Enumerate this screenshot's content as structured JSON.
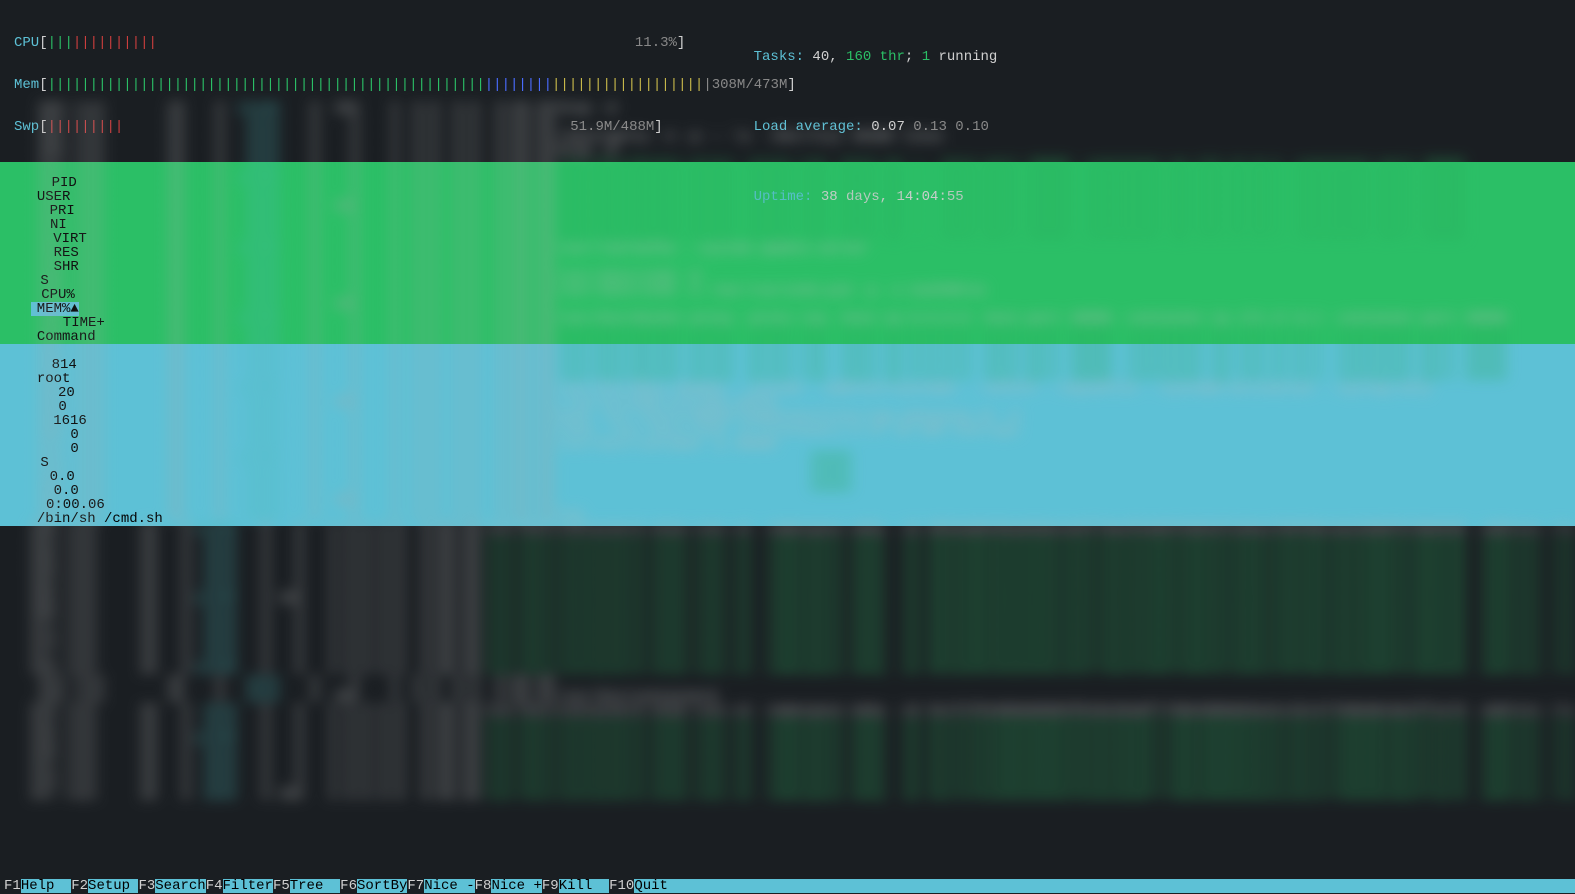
{
  "meters": {
    "cpu": {
      "label": "CPU",
      "pct": "11.3%",
      "green_bars": 3,
      "red_bars": 10
    },
    "mem": {
      "label": "Mem",
      "used": "308M",
      "total": "473M"
    },
    "swp": {
      "label": "Swp",
      "used": "51.9M",
      "total": "488M"
    }
  },
  "stats": {
    "tasks_label": "Tasks: ",
    "tasks_count": "40",
    "tasks_sep": ", ",
    "thr_count": "160",
    "thr_label": " thr",
    "tasks_tail": "; ",
    "running_count": "1",
    "running_label": " running",
    "load_label": "Load average: ",
    "load_1": "0.07",
    "load_2": " 0.13",
    "load_3": " 0.10",
    "uptime_label": "Uptime: ",
    "uptime_value": "38 days, 14:04:55"
  },
  "header": {
    "pid": "PID",
    "user": "USER",
    "pri": "PRI",
    "ni": "NI",
    "virt": "VIRT",
    "res": "RES",
    "shr": "SHR",
    "s": "S",
    "cpu": "CPU%",
    "mem": "MEM%",
    "sort_indicator": "▲",
    "time": "TIME+",
    "command": "Command"
  },
  "selected": {
    "pid": "814",
    "user": "root",
    "pri": "20",
    "ni": "0",
    "virt": "1616",
    "res": "0",
    "shr": "0",
    "s": "S",
    "cpu": "0.0",
    "mem": "0.0",
    "time": "0:00.06",
    "command": "/bin/sh /cmd.sh"
  },
  "footer": [
    {
      "key": "F1",
      "label": "Help  "
    },
    {
      "key": "F2",
      "label": "Setup "
    },
    {
      "key": "F3",
      "label": "Search"
    },
    {
      "key": "F4",
      "label": "Filter"
    },
    {
      "key": "F5",
      "label": "Tree  "
    },
    {
      "key": "F6",
      "label": "SortBy"
    },
    {
      "key": "F7",
      "label": "Nice -"
    },
    {
      "key": "F8",
      "label": "Nice +"
    },
    {
      "key": "F9",
      "label": "Kill  "
    },
    {
      "key": "F10",
      "label": "Quit  "
    }
  ]
}
